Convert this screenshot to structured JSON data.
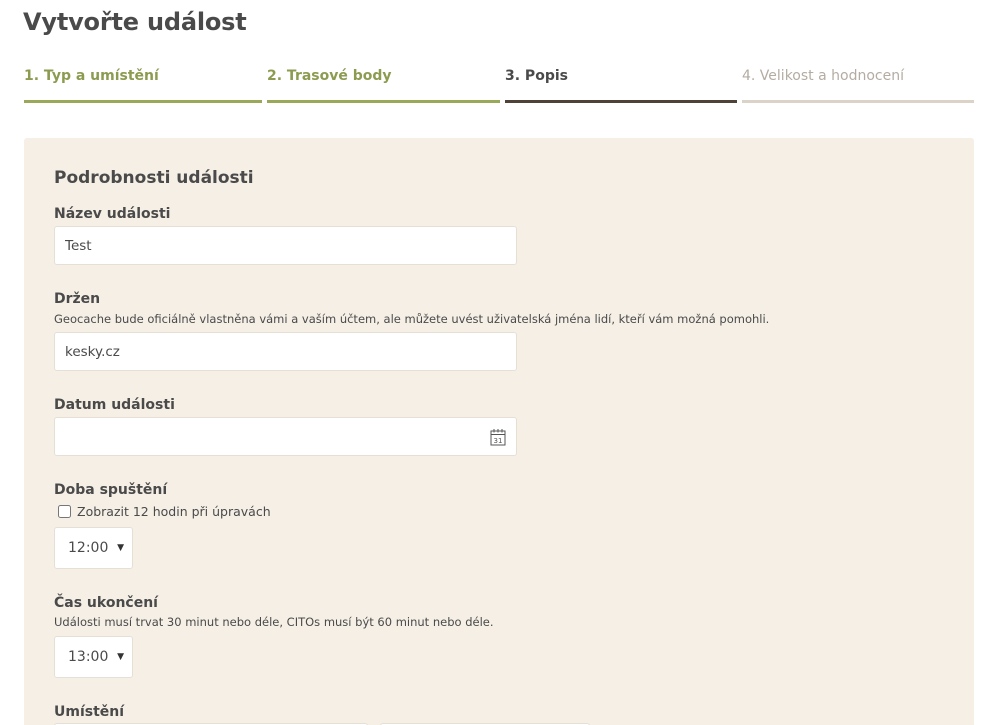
{
  "page": {
    "title": "Vytvořte událost"
  },
  "steps": [
    {
      "label": "1. Typ a umístění",
      "state": "done"
    },
    {
      "label": "2. Trasové body",
      "state": "done"
    },
    {
      "label": "3. Popis",
      "state": "active"
    },
    {
      "label": "4. Velikost a hodnocení",
      "state": "future"
    }
  ],
  "colors": {
    "step_done": "#9aa85a",
    "step_active": "#4f4236",
    "step_future": "#dcd3c8",
    "panel_background": "#f5efe6"
  },
  "form": {
    "section_title": "Podrobnosti události",
    "event_name": {
      "label": "Název události",
      "value": "Test"
    },
    "owner": {
      "label": "Držen",
      "help": "Geocache bude oficiálně vlastněna vámi a vaším účtem, ale můžete uvést uživatelská jména lidí, kteří vám možná pomohli.",
      "value": "kesky.cz"
    },
    "event_date": {
      "label": "Datum události",
      "value": "",
      "icon": "calendar-icon",
      "icon_day": "31"
    },
    "start_time": {
      "label": "Doba spuštění",
      "checkbox_label": "Zobrazit 12 hodin při úpravách",
      "checkbox_checked": false,
      "value": "12:00"
    },
    "end_time": {
      "label": "Čas ukončení",
      "help": "Události musí trvat 30 minut nebo déle, CITOs musí být 60 minut nebo déle.",
      "value": "13:00"
    },
    "location": {
      "label": "Umístění"
    }
  }
}
